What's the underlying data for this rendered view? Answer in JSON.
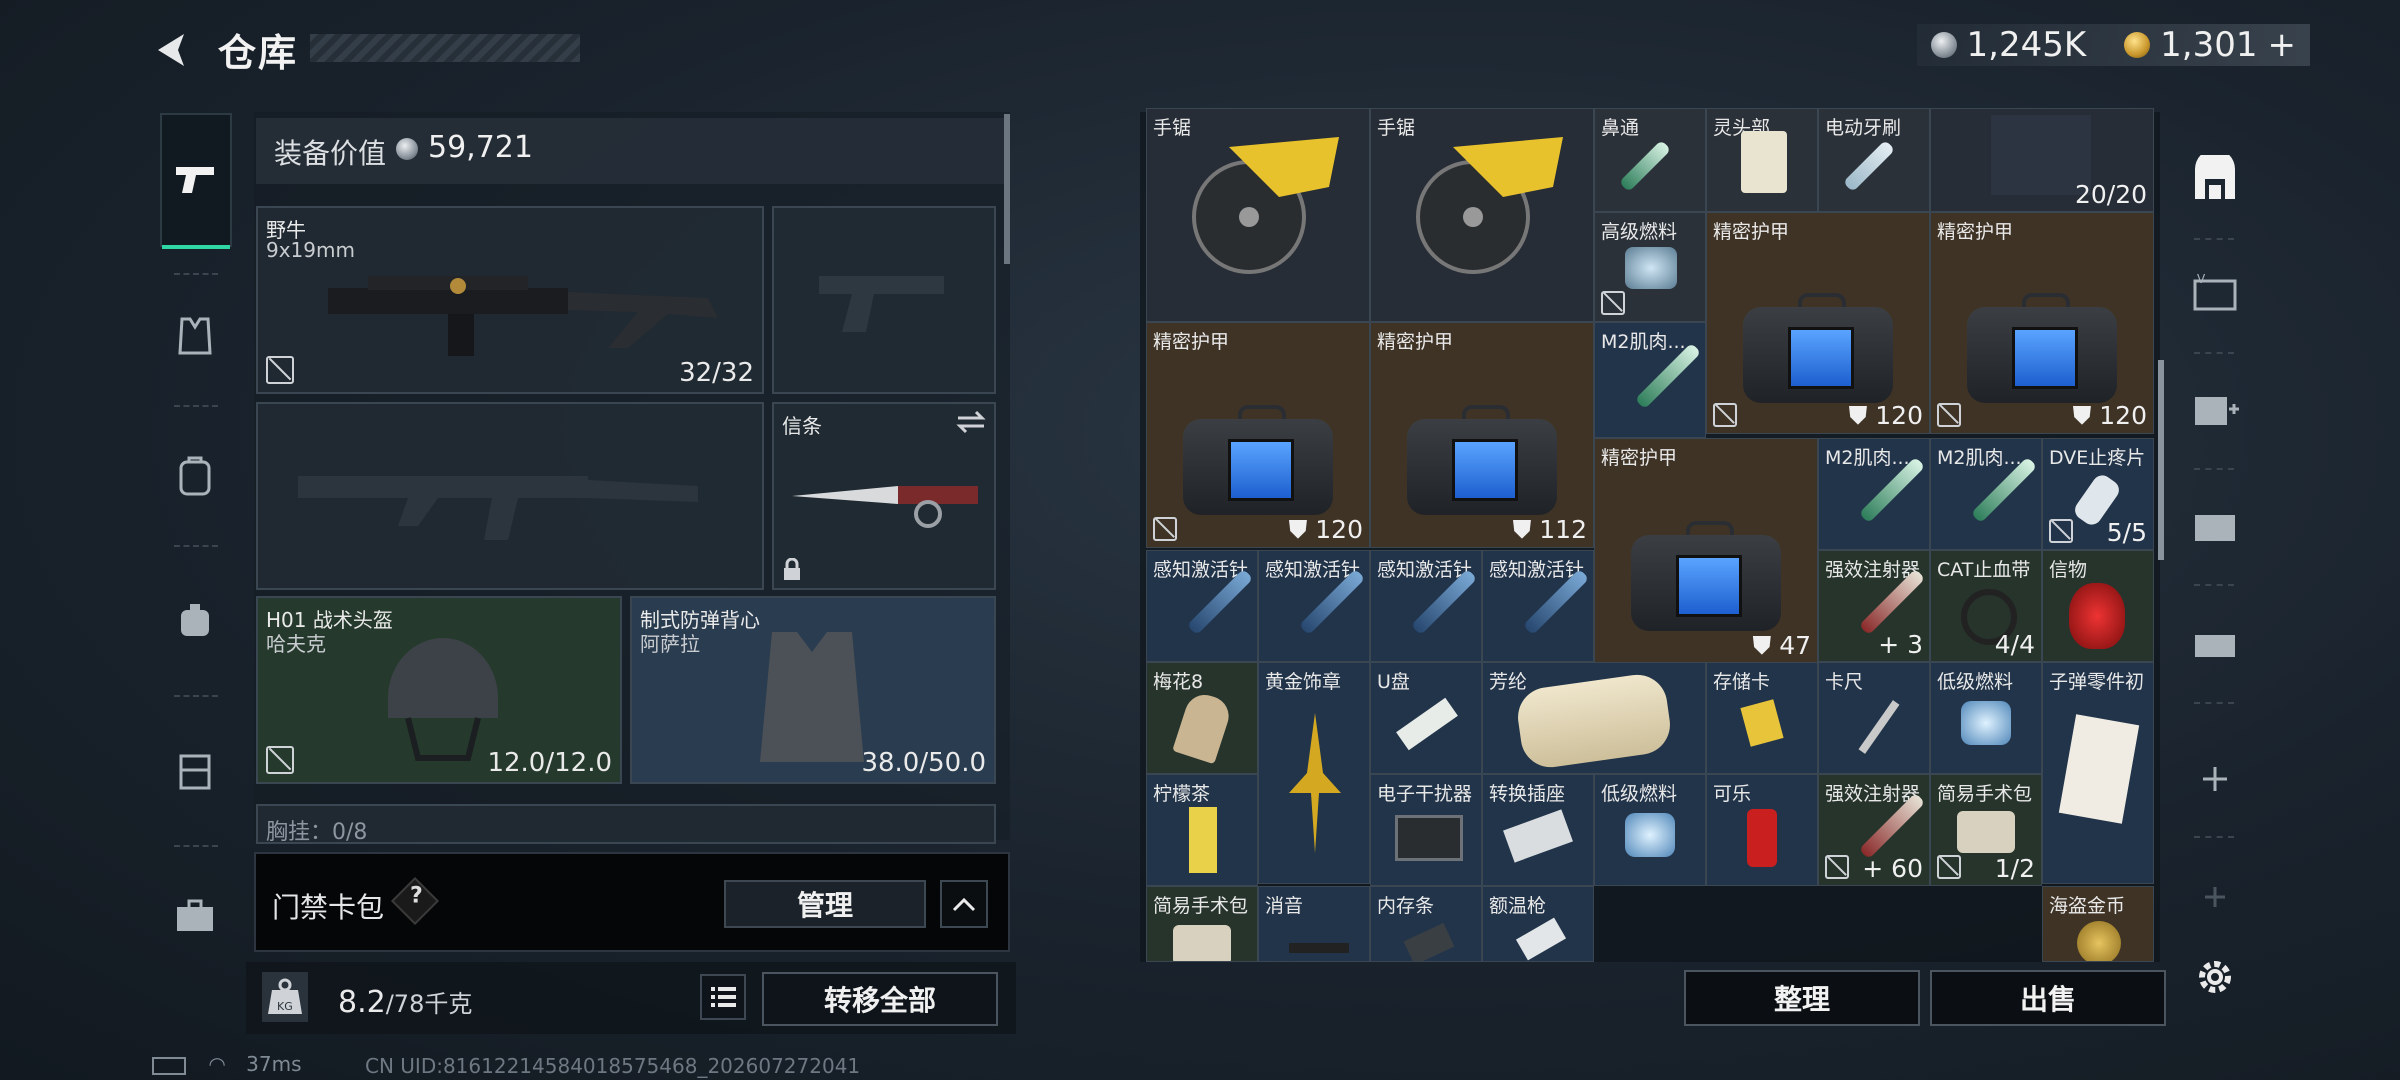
{
  "header": {
    "title": "仓库",
    "currency_silver": "1,245K",
    "currency_gold": "1,301",
    "currency_gold_plus": "+"
  },
  "equipment": {
    "value_label": "装备价值",
    "value": "59,721",
    "primary_weapon": {
      "name": "野牛",
      "caliber": "9x19mm",
      "ammo": "32/32"
    },
    "melee": {
      "name": "信条"
    },
    "helmet": {
      "name": "H01 战术头盔",
      "sub": "哈夫克",
      "durability": "12.0/12.0"
    },
    "armor": {
      "name": "制式防弹背心",
      "sub": "阿萨拉",
      "durability": "38.0/50.0"
    },
    "chest_rig_partial": "胸挂：0/8"
  },
  "card_bag": {
    "label": "门禁卡包",
    "help": "?",
    "manage": "管理"
  },
  "weight": {
    "current": "8.2",
    "max": "/78千克"
  },
  "transfer_all": "转移全部",
  "status": {
    "ping": "37ms",
    "uid": "CN UID:8161221458401857546​8_202607272041"
  },
  "inventory": {
    "top_row": [
      "手锯",
      "手锯",
      "鼻通",
      "灵头部",
      "电动牙刷"
    ],
    "top_right_count": "20/20",
    "items": [
      {
        "label": "高级燃料"
      },
      {
        "label": "精密护甲",
        "count": "120"
      },
      {
        "label": "精密护甲",
        "count": "120"
      },
      {
        "label": "精密护甲",
        "count": "120"
      },
      {
        "label": "精密护甲",
        "count": "112"
      },
      {
        "label": "M2肌肉..."
      },
      {
        "label": "精密护甲",
        "count": "47"
      },
      {
        "label": "M2肌肉..."
      },
      {
        "label": "M2肌肉..."
      },
      {
        "label": "DVE止疼片",
        "count": "5/5"
      },
      {
        "label": "感知激活针"
      },
      {
        "label": "感知激活针"
      },
      {
        "label": "感知激活针"
      },
      {
        "label": "感知激活针"
      },
      {
        "label": "强效注射器",
        "count": "+ 3"
      },
      {
        "label": "CAT止血带",
        "count": "4/4"
      },
      {
        "label": "信物"
      },
      {
        "label": "梅花8"
      },
      {
        "label": "黄金饰章"
      },
      {
        "label": "U盘"
      },
      {
        "label": "芳纶"
      },
      {
        "label": "存储卡"
      },
      {
        "label": "卡尺"
      },
      {
        "label": "低级燃料"
      },
      {
        "label": "子弹零件初"
      },
      {
        "label": "柠檬茶"
      },
      {
        "label": "电子干扰器"
      },
      {
        "label": "转换插座"
      },
      {
        "label": "低级燃料"
      },
      {
        "label": "可乐"
      },
      {
        "label": "强效注射器",
        "count": "+ 60"
      },
      {
        "label": "简易手术包",
        "count": "1/2"
      },
      {
        "label": "简易手术包"
      },
      {
        "label": "消音"
      },
      {
        "label": "内存条"
      },
      {
        "label": "额温枪"
      },
      {
        "label": "海盗金币"
      }
    ]
  },
  "actions": {
    "sort": "整理",
    "sell": "出售"
  },
  "colors": {
    "accent": "#2fd7a5",
    "brown_cell": "#3f3326",
    "blue_cell": "#22344a"
  }
}
